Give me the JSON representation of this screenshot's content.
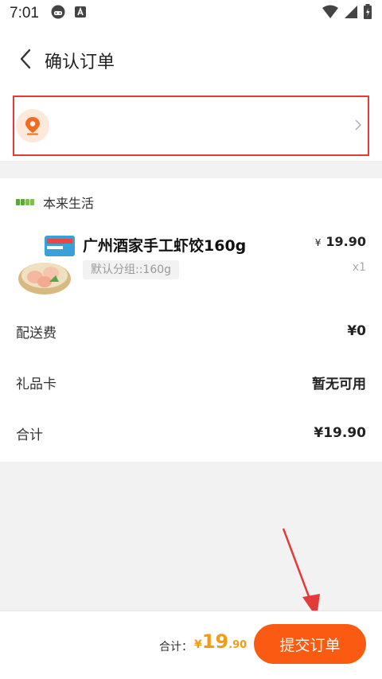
{
  "status": {
    "time": "7:01",
    "left_icons": [
      "gamepad-icon",
      "a-badge-icon"
    ],
    "right_icons": [
      "wifi-icon",
      "signal-icon",
      "battery-icon"
    ]
  },
  "header": {
    "title": "确认订单",
    "back_icon": "chevron-left-icon"
  },
  "address": {
    "icon": "location-pin-icon",
    "chevron": "chevron-right-icon",
    "highlight_color": "#e43a3a"
  },
  "store": {
    "name": "本来生活",
    "logo_icon": "store-logo-icon"
  },
  "product": {
    "name": "广州酒家手工虾饺160g",
    "variant": "默认分组::160g",
    "price_currency": "¥",
    "price": "19.90",
    "quantity": "x1"
  },
  "fees": [
    {
      "label": "配送费",
      "value": "¥0"
    },
    {
      "label": "礼品卡",
      "value": "暂无可用"
    },
    {
      "label": "合计",
      "value": "¥19.90"
    }
  ],
  "footer": {
    "total_label": "合计：",
    "total_currency": "¥",
    "total_integer": "19",
    "total_decimal": ".90",
    "submit_label": "提交订单"
  },
  "colors": {
    "accent": "#fb5a12",
    "price": "#f39c12",
    "annotation": "#e43a3a"
  }
}
